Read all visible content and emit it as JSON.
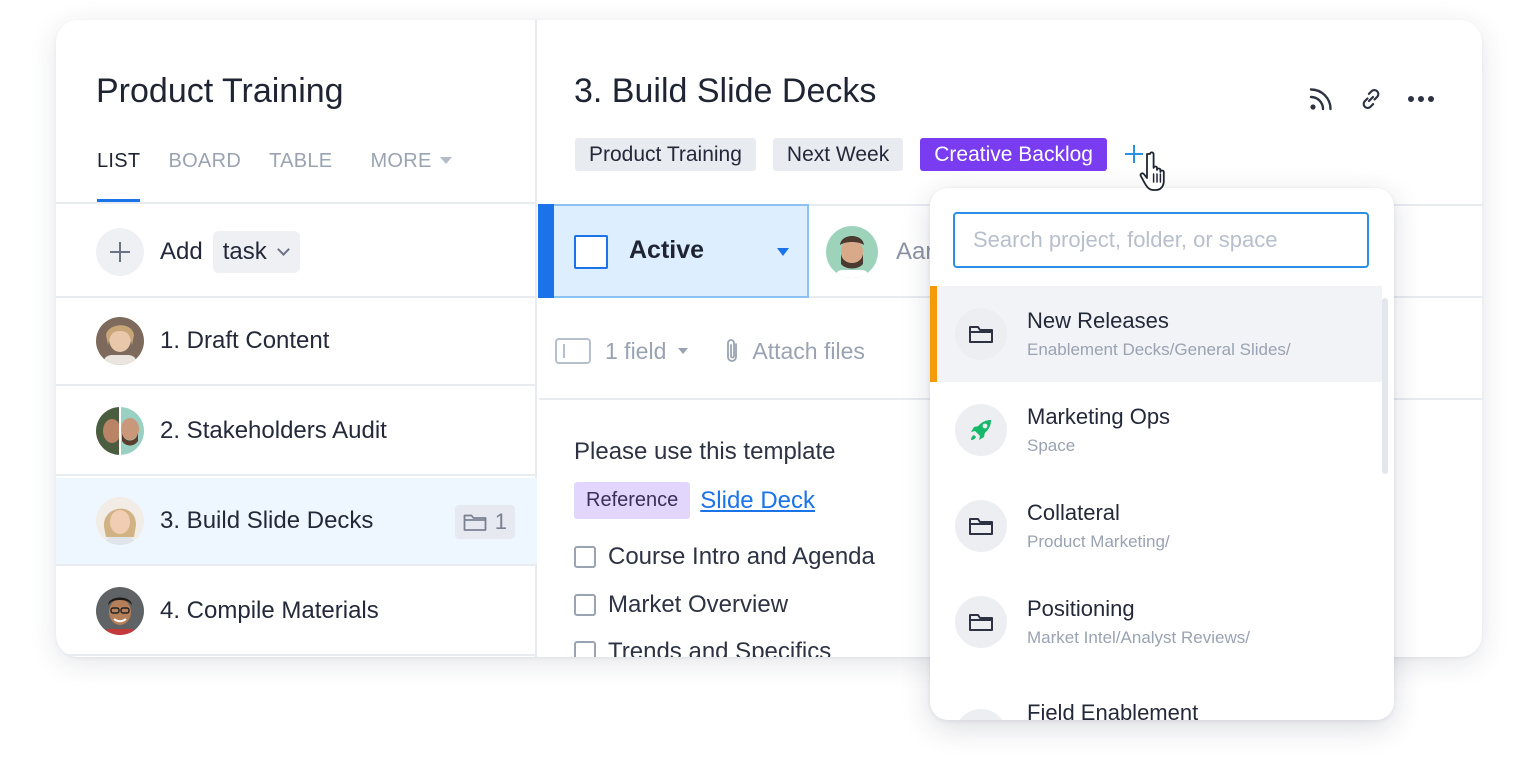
{
  "left": {
    "title": "Product Training",
    "tabs": [
      {
        "label": "LIST"
      },
      {
        "label": "BOARD"
      },
      {
        "label": "TABLE"
      },
      {
        "label": "MORE"
      }
    ],
    "add": {
      "label": "Add",
      "type": "task"
    },
    "tasks": [
      {
        "name": "1. Draft Content"
      },
      {
        "name": "2. Stakeholders Audit"
      },
      {
        "name": "3. Build Slide Decks",
        "badge_count": "1"
      },
      {
        "name": "4. Compile Materials"
      }
    ]
  },
  "detail": {
    "title": "3. Build Slide Decks",
    "icons": [
      "rss-icon",
      "link-icon",
      "more-icon"
    ],
    "tags": [
      "Product Training",
      "Next Week",
      "Creative Backlog"
    ],
    "add_tag": "+",
    "status": "Active",
    "assignee_name": "Aar",
    "fields_label": "1 field",
    "attach_label": "Attach files",
    "description": "Please use this template",
    "reference_chip": "Reference",
    "reference_link": "Slide Deck",
    "checklist": [
      "Course Intro and Agenda",
      "Market Overview",
      "Trends and Specifics"
    ]
  },
  "dropdown": {
    "placeholder": "Search project, folder, or space",
    "items": [
      {
        "name": "New Releases",
        "path": "Enablement Decks/General Slides/",
        "icon": "folder-icon"
      },
      {
        "name": "Marketing Ops",
        "path": "Space",
        "icon": "rocket-icon"
      },
      {
        "name": "Collateral",
        "path": "Product Marketing/",
        "icon": "folder-icon"
      },
      {
        "name": "Positioning",
        "path": "Market Intel/Analyst Reviews/",
        "icon": "folder-icon"
      },
      {
        "name": "Field Enablement",
        "path": "",
        "icon": "project-icon"
      }
    ]
  },
  "colors": {
    "accent": "#1a73e8",
    "tag_purple": "#7a3cf0",
    "highlight_bar": "#f49b0c",
    "status_bg": "#ddeefe"
  }
}
